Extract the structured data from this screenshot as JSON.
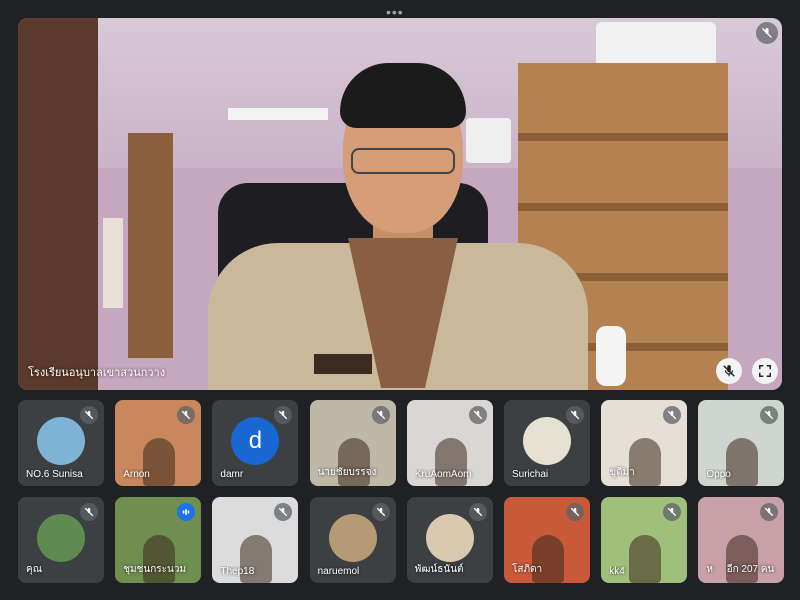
{
  "header": {
    "more_dots": "•••"
  },
  "main_speaker": {
    "name": "โรงเรียนอนุบาลเขาสวนกวาง",
    "icons": {
      "mute": "mic-off-icon",
      "pin": "mic-off-icon",
      "fullscreen": "fullscreen-icon"
    }
  },
  "tiles": [
    {
      "name": "NO.6 Sunisa",
      "kind": "avatar",
      "avatar_color": "#7fb3d5"
    },
    {
      "name": "Arnon",
      "kind": "video",
      "bg": "#c8875c"
    },
    {
      "name": "damr",
      "kind": "letter",
      "letter": "d"
    },
    {
      "name": "นายชัยบรรจง",
      "kind": "video",
      "bg": "#bfb7a8"
    },
    {
      "name": "KruAomAom",
      "kind": "video",
      "bg": "#d9d6d3"
    },
    {
      "name": "Surichai",
      "kind": "avatar",
      "avatar_color": "#e7e1d4"
    },
    {
      "name": "ขุดิมา",
      "kind": "video",
      "bg": "#e5dfd6"
    },
    {
      "name": "Oppo",
      "kind": "video",
      "bg": "#cfd6cf"
    },
    {
      "name": "คุณ",
      "kind": "avatar",
      "avatar_color": "#5f8a52"
    },
    {
      "name": "ชุมชนกระนวม",
      "kind": "video",
      "bg": "#6f8f4f",
      "speaking": true
    },
    {
      "name": "Thep18",
      "kind": "video",
      "bg": "#dcdcdc"
    },
    {
      "name": "naruemol",
      "kind": "avatar",
      "avatar_color": "#b59a76"
    },
    {
      "name": "พัฒน์ธนันต์",
      "kind": "avatar",
      "avatar_color": "#d8c9b0"
    },
    {
      "name": "โสภิดา",
      "kind": "video",
      "bg": "#c85a3a"
    },
    {
      "name": "kk4",
      "kind": "video",
      "bg": "#9fbf7a"
    },
    {
      "name": "ห",
      "kind": "video",
      "bg": "#c9a0a8",
      "more": "อีก 207 คน"
    }
  ]
}
